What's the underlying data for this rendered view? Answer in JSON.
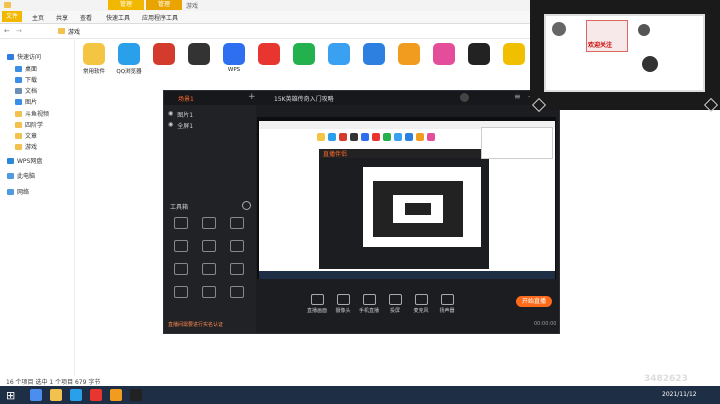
{
  "explorer": {
    "context_tabs": [
      "管理",
      "管理"
    ],
    "window_title": "游戏",
    "ribbon_tabs": [
      "文件",
      "主页",
      "共享",
      "查看",
      "快速工具",
      "应用程序工具"
    ],
    "address_path": "游戏",
    "sidebar": [
      {
        "label": "快速访问",
        "icon": "star-icon",
        "color": "#2f7de1"
      },
      {
        "label": "桌面",
        "icon": "desktop-icon",
        "color": "#3a8ee6"
      },
      {
        "label": "下载",
        "icon": "download-icon",
        "color": "#3a8ee6"
      },
      {
        "label": "文档",
        "icon": "document-icon",
        "color": "#6c8fb8"
      },
      {
        "label": "图片",
        "icon": "picture-icon",
        "color": "#3a8ee6"
      },
      {
        "label": "斗鱼视频",
        "icon": "folder-icon",
        "color": "#f2c14e"
      },
      {
        "label": "四阶学",
        "icon": "folder-icon",
        "color": "#f2c14e"
      },
      {
        "label": "文章",
        "icon": "folder-icon",
        "color": "#f2c14e"
      },
      {
        "label": "游戏",
        "icon": "folder-icon",
        "color": "#f2c14e"
      },
      {
        "label": "WPS网盘",
        "icon": "cloud-icon",
        "color": "#2b88d8"
      },
      {
        "label": "此电脑",
        "icon": "computer-icon",
        "color": "#4f9be0"
      },
      {
        "label": "网络",
        "icon": "network-icon",
        "color": "#4f9be0"
      }
    ],
    "files": [
      {
        "label": "常用软件",
        "color": "#f4c542"
      },
      {
        "label": "QQ浏览器",
        "color": "#2aa0ea"
      },
      {
        "label": "",
        "color": "#d33c2c"
      },
      {
        "label": "",
        "color": "#333333"
      },
      {
        "label": "WPS",
        "color": "#2e6ff2"
      },
      {
        "label": "",
        "color": "#e8352f"
      },
      {
        "label": "",
        "color": "#22b14c"
      },
      {
        "label": "",
        "color": "#3aa0f2"
      },
      {
        "label": "",
        "color": "#2d7fe0"
      },
      {
        "label": "",
        "color": "#f29c1f"
      },
      {
        "label": "",
        "color": "#e34d9a"
      },
      {
        "label": "",
        "color": "#222222"
      },
      {
        "label": "",
        "color": "#f0c000"
      }
    ],
    "status": "16 个项目  选中 1 个项目  679 字节"
  },
  "app": {
    "scene_tabs": [
      "场景1",
      "",
      ""
    ],
    "sources": [
      "图片1",
      "全屏1"
    ],
    "preview_title": "15K英雄传奇入门攻略",
    "preview_tag": "",
    "tools_panel_label": "工具箱",
    "tools": [
      "",
      "",
      "",
      "",
      "",
      "",
      "",
      "",
      "",
      "",
      "",
      ""
    ],
    "bottom_tools": [
      "直播画面",
      "摄像头",
      "手机直播",
      "投屏",
      "麦克风",
      "扬声器"
    ],
    "start_live": "开始直播",
    "footer_hint": "直播间需要进行实名认证",
    "time": "00:00:00"
  },
  "camera_overlay": {
    "watermark": "3482623",
    "badge_text": "欢迎关注"
  },
  "taskbar": {
    "time": "",
    "date": "2021/11/12",
    "colors": [
      "#4b8ef0",
      "#f2c14e",
      "#2aa0ea",
      "#e8352f",
      "#f29c1f",
      "#222222"
    ]
  }
}
